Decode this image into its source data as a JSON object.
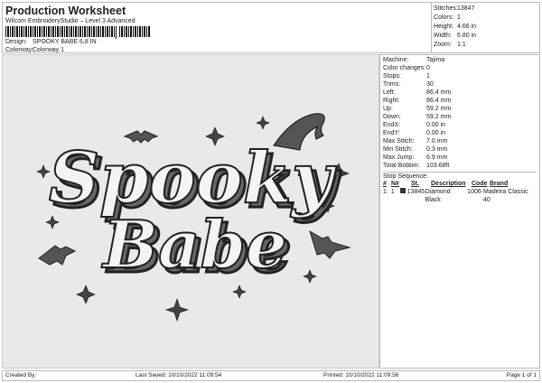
{
  "header": {
    "title": "Production Worksheet",
    "subtitle": "Wilcom EmbroideryStudio – Level 3 Advanced",
    "design_label": "Design:",
    "design": "SPOOKY BABE 6,8 IN",
    "colorway_label": "Colorway:",
    "colorway": "Colorway 1"
  },
  "stats": [
    {
      "k": "Stitches:",
      "v": "13847"
    },
    {
      "k": "Colors:",
      "v": "1"
    },
    {
      "k": "Height:",
      "v": "4.66 in"
    },
    {
      "k": "Width:",
      "v": "6.80 in"
    },
    {
      "k": "Zoom:",
      "v": "1:1"
    }
  ],
  "details": [
    {
      "k": "Machine:",
      "v": "Tajima"
    },
    {
      "k": "Color changes:",
      "v": "0"
    },
    {
      "k": "Stops:",
      "v": "1"
    },
    {
      "k": "Trims:",
      "v": "30"
    },
    {
      "k": "Left:",
      "v": "86.4 mm"
    },
    {
      "k": "Right:",
      "v": "86.4 mm"
    },
    {
      "k": "Up:",
      "v": "59.2 mm"
    },
    {
      "k": "Down:",
      "v": "59.2 mm"
    },
    {
      "k": "EndX:",
      "v": "0.00 in"
    },
    {
      "k": "EndY:",
      "v": "0.00 in"
    },
    {
      "k": "Max Stitch:",
      "v": "7.0 mm"
    },
    {
      "k": "Min Stitch:",
      "v": "0.3 mm"
    },
    {
      "k": "Max Jump:",
      "v": "6.9 mm"
    },
    {
      "k": "Total Bobbin:",
      "v": "103.68ft"
    }
  ],
  "stop_sequence": {
    "label": "Stop Sequence:",
    "headers": [
      "#",
      "N#",
      "St.",
      "Description",
      "Code",
      "Brand"
    ],
    "rows": [
      {
        "num": "1.",
        "n": "1",
        "st": "13845",
        "desc": "Diamond Black",
        "code": "1006",
        "brand": "Madeira Classic 40",
        "color": "#333333"
      }
    ]
  },
  "design_art": {
    "line1": "Spooky",
    "line2": "Babe"
  },
  "footer": {
    "created": "Created By:",
    "saved": "Last Saved: 10/10/2022 11:09:54",
    "printed": "Printed: 10/10/2022 11:09:56",
    "page": "Page 1 of 1"
  }
}
